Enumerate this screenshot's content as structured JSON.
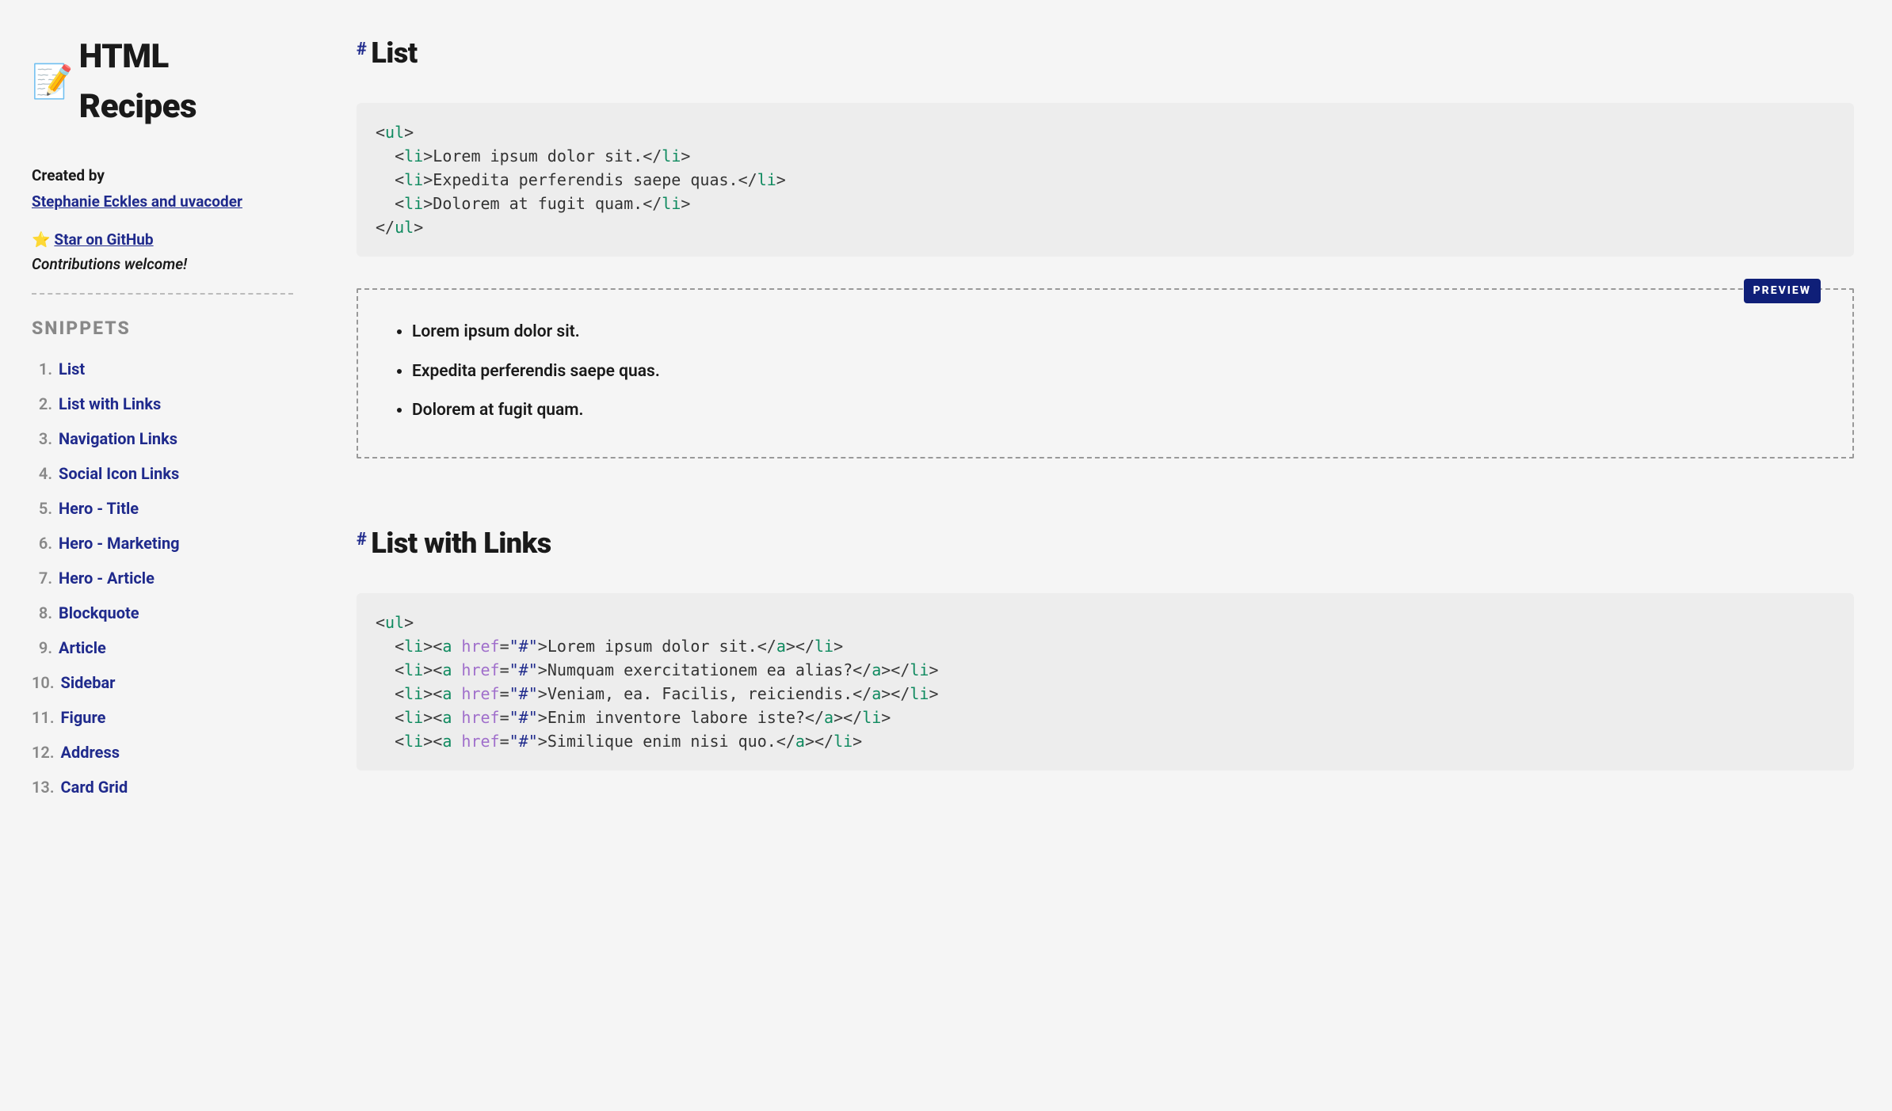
{
  "site": {
    "emoji": "📝",
    "title": "HTML Recipes",
    "created_by_label": "Created by",
    "author": "Stephanie Eckles and uvacoder",
    "star_emoji": "⭐",
    "star_label": "Star on GitHub",
    "contrib": "Contributions welcome!"
  },
  "toc": {
    "heading": "Snippets",
    "items": [
      "List",
      "List with Links",
      "Navigation Links",
      "Social Icon Links",
      "Hero - Title",
      "Hero - Marketing",
      "Hero - Article",
      "Blockquote",
      "Article",
      "Sidebar",
      "Figure",
      "Address",
      "Card Grid"
    ]
  },
  "section1": {
    "hash": "#",
    "title": "List",
    "code": {
      "open_ul_1": "<",
      "open_ul_tag": "ul",
      "open_ul_2": ">",
      "li_open_1": "<",
      "li_tag": "li",
      "li_open_2": ">",
      "li1_text": "Lorem ipsum dolor sit.",
      "li_close_1": "</",
      "li_close_2": ">",
      "li2_text": "Expedita perferendis saepe quas.",
      "li3_text": "Dolorem at fugit quam.",
      "close_ul_1": "</",
      "close_ul_2": ">"
    },
    "preview_label": "PREVIEW",
    "preview_items": [
      "Lorem ipsum dolor sit.",
      "Expedita perferendis saepe quas.",
      "Dolorem at fugit quam."
    ]
  },
  "section2": {
    "hash": "#",
    "title": "List with Links",
    "code": {
      "ul": "ul",
      "li": "li",
      "a": "a",
      "href_name": "href",
      "href_val": "\"#\"",
      "items": [
        "Lorem ipsum dolor sit.",
        "Numquam exercitationem ea alias?",
        "Veniam, ea. Facilis, reiciendis.",
        "Enim inventore labore iste?",
        "Similique enim nisi quo."
      ]
    }
  }
}
